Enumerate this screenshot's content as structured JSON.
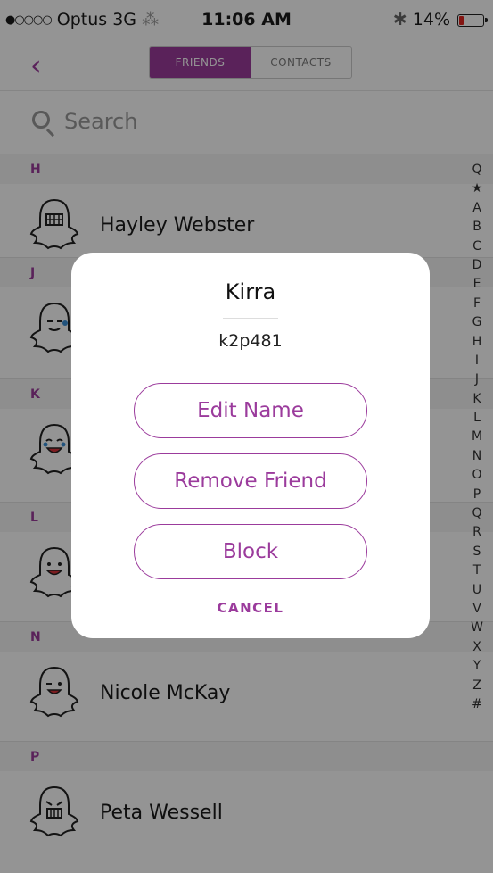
{
  "status_bar": {
    "carrier": "Optus",
    "network": "3G",
    "time": "11:06 AM",
    "battery": "14%"
  },
  "nav": {
    "tabs": [
      "FRIENDS",
      "CONTACTS"
    ]
  },
  "search": {
    "placeholder": "Search"
  },
  "sections": [
    {
      "letter": "H",
      "friends": [
        "Hayley Webster"
      ]
    },
    {
      "letter": "J",
      "friends": [
        ""
      ]
    },
    {
      "letter": "K",
      "friends": [
        ""
      ]
    },
    {
      "letter": "L",
      "friends": [
        ""
      ]
    },
    {
      "letter": "N",
      "friends": [
        "Nicole McKay"
      ]
    },
    {
      "letter": "P",
      "friends": [
        "Peta Wessell"
      ]
    }
  ],
  "alphabet_index": [
    "Q",
    "★",
    "A",
    "B",
    "C",
    "D",
    "E",
    "F",
    "G",
    "H",
    "I",
    "J",
    "K",
    "L",
    "M",
    "N",
    "O",
    "P",
    "Q",
    "R",
    "S",
    "T",
    "U",
    "V",
    "W",
    "X",
    "Y",
    "Z",
    "#"
  ],
  "modal": {
    "name": "Kirra",
    "username": "k2p481",
    "buttons": [
      "Edit Name",
      "Remove Friend",
      "Block"
    ],
    "cancel": "CANCEL"
  },
  "colors": {
    "accent": "#9b3b9c",
    "battery_low": "#e2251f"
  }
}
